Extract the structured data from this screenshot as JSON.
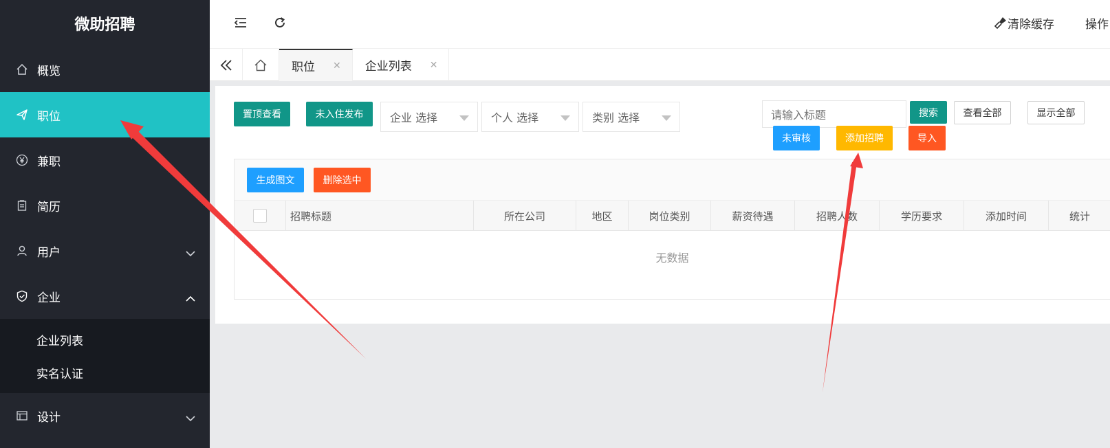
{
  "app": {
    "title": "微助招聘"
  },
  "sidebar": {
    "items": [
      {
        "label": "概览",
        "icon": "home-icon"
      },
      {
        "label": "职位",
        "icon": "send-icon"
      },
      {
        "label": "兼职",
        "icon": "yen-icon"
      },
      {
        "label": "简历",
        "icon": "clipboard-icon"
      },
      {
        "label": "用户",
        "icon": "user-icon"
      },
      {
        "label": "企业",
        "icon": "shield-icon"
      },
      {
        "label": "设计",
        "icon": "window-icon"
      }
    ],
    "submenu": [
      {
        "label": "企业列表"
      },
      {
        "label": "实名认证"
      }
    ]
  },
  "header": {
    "clear_cache": "清除缓存",
    "ops": "操作"
  },
  "tabs": [
    {
      "label": "职位"
    },
    {
      "label": "企业列表"
    }
  ],
  "filters": {
    "top_btn": "置顶查看",
    "unlisted_btn": "未入住发布",
    "company_select": "企业 选择",
    "person_select": "个人 选择",
    "category_select": "类别 选择",
    "search_placeholder": "请输入标题",
    "search_btn": "搜索",
    "view_all_btn": "查看全部",
    "show_all_btn": "显示全部",
    "unreviewed_btn": "未审核",
    "add_btn": "添加招聘",
    "import_btn": "导入"
  },
  "table": {
    "gen_btn": "生成图文",
    "delete_btn": "删除选中",
    "columns": [
      "招聘标题",
      "所在公司",
      "地区",
      "岗位类别",
      "薪资待遇",
      "招聘人数",
      "学历要求",
      "添加时间",
      "统计"
    ],
    "empty": "无数据"
  },
  "colors": {
    "sidebar_bg": "#23262e",
    "active": "#20c2c5",
    "teal": "#119688",
    "blue": "#1e9fff",
    "orange": "#ff5722",
    "yellow": "#ffb800",
    "arrow": "#f03b3b"
  }
}
